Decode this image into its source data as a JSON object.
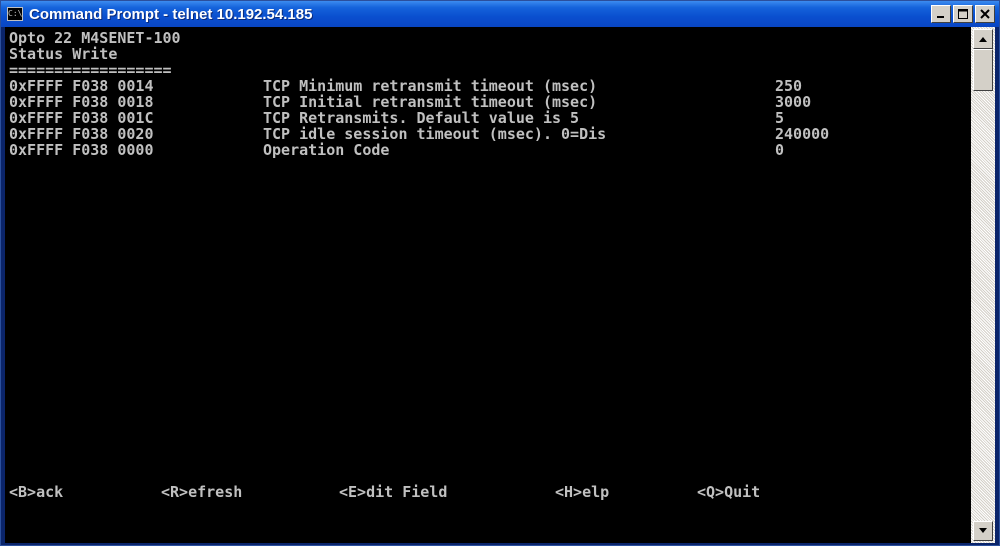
{
  "window": {
    "title": "Command Prompt - telnet 10.192.54.185",
    "icon": "command-prompt-icon",
    "icon_glyph": "C:\\",
    "buttons": {
      "minimize": "minimize-icon",
      "maximize": "maximize-icon",
      "close": "close-icon"
    }
  },
  "console": {
    "header": [
      "Opto 22 M4SENET-100",
      "Status Write",
      "=================="
    ],
    "rows": [
      {
        "address": "0xFFFF F038 0014",
        "description": "TCP Minimum retransmit timeout (msec)",
        "value": "250"
      },
      {
        "address": "0xFFFF F038 0018",
        "description": "TCP Initial retransmit timeout (msec)",
        "value": "3000"
      },
      {
        "address": "0xFFFF F038 001C",
        "description": "TCP Retransmits. Default value is 5",
        "value": "5"
      },
      {
        "address": "0xFFFF F038 0020",
        "description": "TCP idle session timeout (msec). 0=Dis",
        "value": "240000"
      },
      {
        "address": "0xFFFF F038 0000",
        "description": "Operation Code",
        "value": "0"
      }
    ],
    "menu": [
      "<B>ack",
      "<R>efresh",
      "<E>dit Field",
      "<H>elp",
      "<Q>Quit"
    ]
  },
  "colors": {
    "console_bg": "#000000",
    "console_text": "#c0c0c0",
    "titlebar": "#0a4fcf"
  }
}
